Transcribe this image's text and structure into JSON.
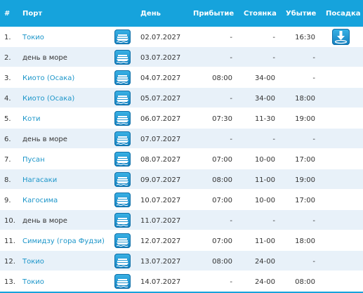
{
  "headers": {
    "num": "#",
    "port": "Порт",
    "day": "День",
    "arrival": "Прибытие",
    "stay": "Стоянка",
    "departure": "Убытие",
    "boarding": "Посадка"
  },
  "rows": [
    {
      "num": "1.",
      "port": "Токио",
      "date": "02.07.2027",
      "arrival": "-",
      "stay": "-",
      "departure": "16:30"
    },
    {
      "num": "2.",
      "port": "день в море",
      "date": "03.07.2027",
      "arrival": "-",
      "stay": "-",
      "departure": "-"
    },
    {
      "num": "3.",
      "port": "Киото (Осака)",
      "date": "04.07.2027",
      "arrival": "08:00",
      "stay": "34-00",
      "departure": "-"
    },
    {
      "num": "4.",
      "port": "Киото (Осака)",
      "date": "05.07.2027",
      "arrival": "-",
      "stay": "34-00",
      "departure": "18:00"
    },
    {
      "num": "5.",
      "port": "Коти",
      "date": "06.07.2027",
      "arrival": "07:30",
      "stay": "11-30",
      "departure": "19:00"
    },
    {
      "num": "6.",
      "port": "день в море",
      "date": "07.07.2027",
      "arrival": "-",
      "stay": "-",
      "departure": "-"
    },
    {
      "num": "7.",
      "port": "Пусан",
      "date": "08.07.2027",
      "arrival": "07:00",
      "stay": "10-00",
      "departure": "17:00"
    },
    {
      "num": "8.",
      "port": "Нагасаки",
      "date": "09.07.2027",
      "arrival": "08:00",
      "stay": "11-00",
      "departure": "19:00"
    },
    {
      "num": "9.",
      "port": "Кагосима",
      "date": "10.07.2027",
      "arrival": "07:00",
      "stay": "10-00",
      "departure": "17:00"
    },
    {
      "num": "10.",
      "port": "день в море",
      "date": "11.07.2027",
      "arrival": "-",
      "stay": "-",
      "departure": "-"
    },
    {
      "num": "11.",
      "port": "Симидзу (гора Фудзи)",
      "date": "12.07.2027",
      "arrival": "07:00",
      "stay": "11-00",
      "departure": "18:00"
    },
    {
      "num": "12.",
      "port": "Токио",
      "date": "13.07.2027",
      "arrival": "08:00",
      "stay": "24-00",
      "departure": "-"
    },
    {
      "num": "13.",
      "port": "Токио",
      "date": "14.07.2027",
      "arrival": "-",
      "stay": "24-00",
      "departure": "08:00"
    }
  ],
  "icons": {
    "ship": "ship-icon",
    "boarding": "boarding-download-icon"
  },
  "colors": {
    "header_bg": "#16a3dc",
    "link": "#1b95c9",
    "row_alt": "#e8f1f9"
  }
}
